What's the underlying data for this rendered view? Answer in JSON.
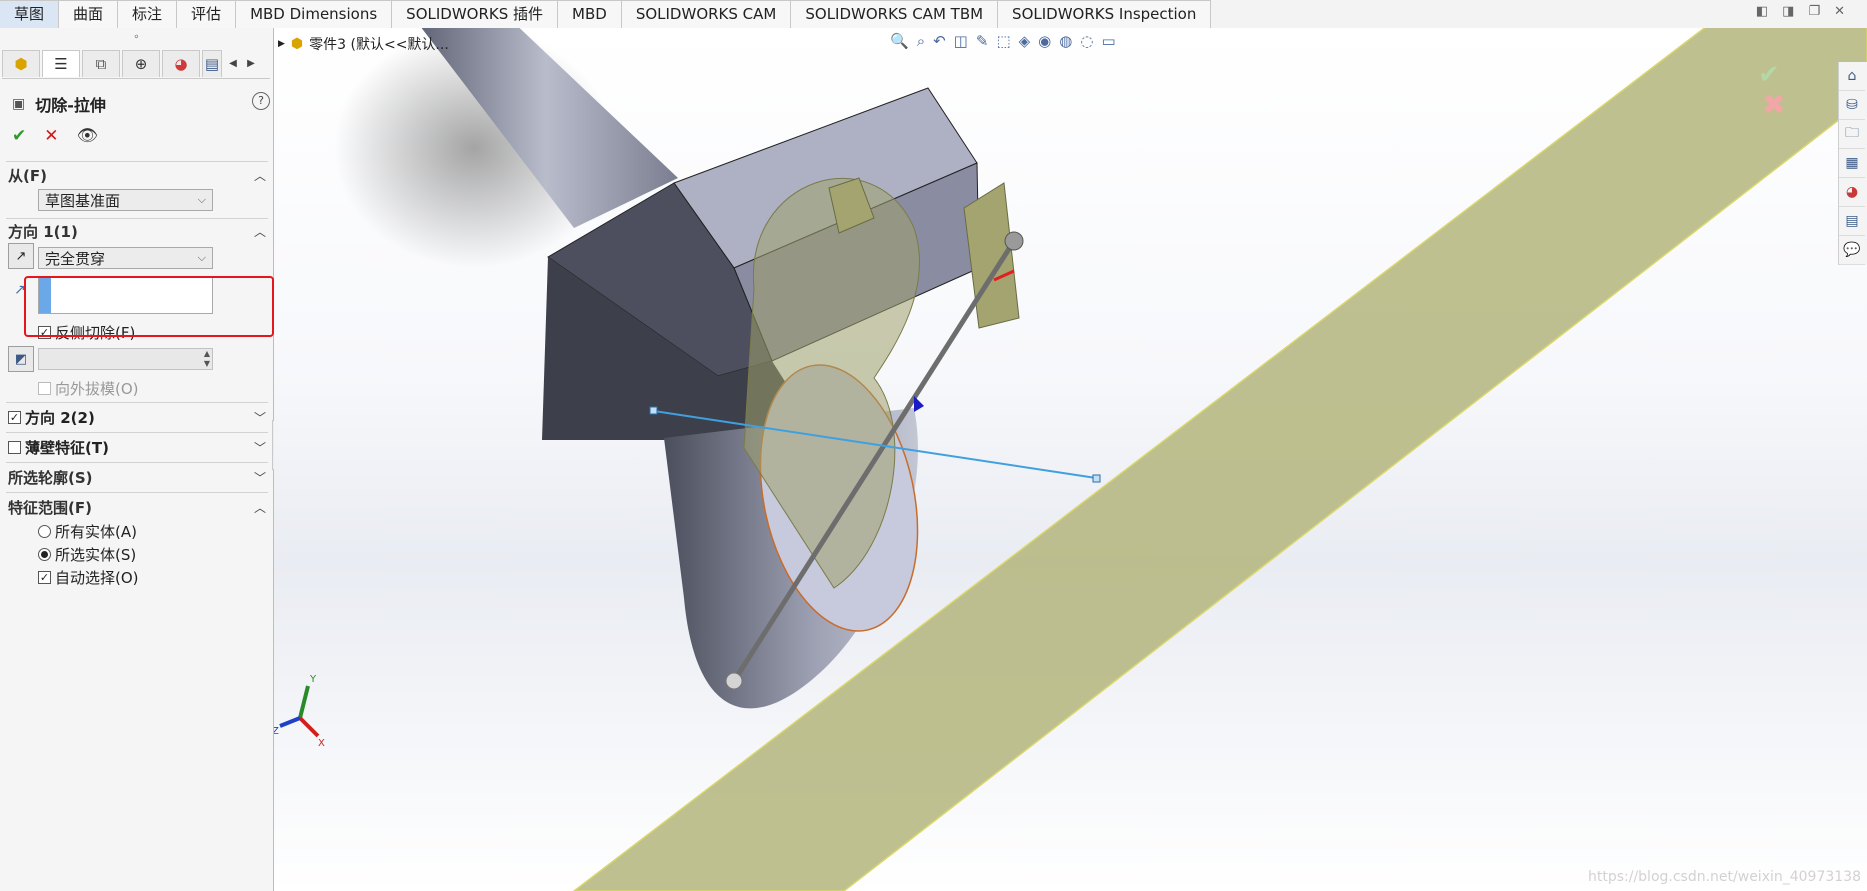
{
  "tabs": [
    "草图",
    "曲面",
    "标注",
    "评估",
    "MBD Dimensions",
    "SOLIDWORKS 插件",
    "MBD",
    "SOLIDWORKS CAM",
    "SOLIDWORKS CAM TBM",
    "SOLIDWORKS Inspection"
  ],
  "active_tab": "草图",
  "window_controls": [
    "restore-left",
    "restore-right",
    "restore",
    "close"
  ],
  "breadcrumb": {
    "label": "零件3 (默认<<默认..."
  },
  "property_manager": {
    "title": "切除-拉伸",
    "help": "?",
    "from": {
      "header": "从(F)",
      "value": "草图基准面"
    },
    "direction1": {
      "header": "方向 1(1)",
      "end_condition": "完全贯穿",
      "flip_side_label": "反侧切除(F)",
      "flip_side_checked": true,
      "draft_label": "向外拔模(O)",
      "draft_checked": false
    },
    "direction2": {
      "header": "方向 2(2)",
      "checked": true
    },
    "thin_feature": {
      "header": "薄壁特征(T)",
      "checked": false
    },
    "selected_contours": {
      "header": "所选轮廓(S)"
    },
    "feature_scope": {
      "header": "特征范围(F)",
      "all_bodies": "所有实体(A)",
      "selected_bodies": "所选实体(S)",
      "selected_value": "selected_bodies",
      "auto_select": "自动选择(O)",
      "auto_select_checked": true
    }
  },
  "triad": {
    "x": "X",
    "y": "Y",
    "z": "Z"
  },
  "watermark": "https://blog.csdn.net/weixin_40973138",
  "colors": {
    "plane": "#b4b57c",
    "highlight": "#e5161c",
    "sketch_line": "#3fa0e0",
    "body": "#8a8ea3"
  }
}
